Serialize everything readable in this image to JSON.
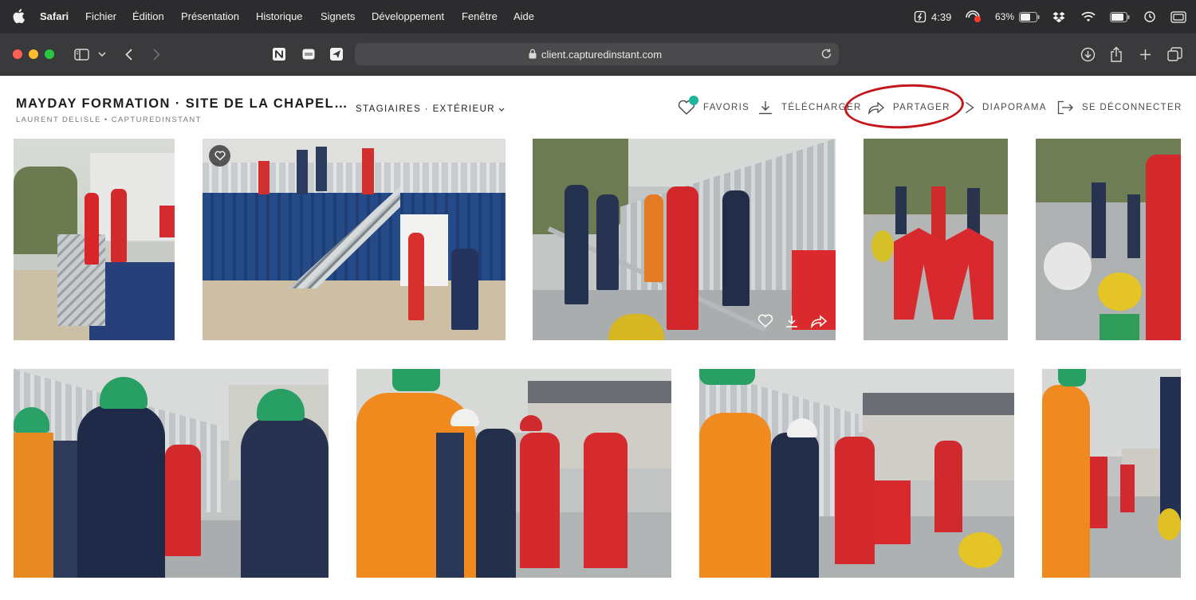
{
  "menubar": {
    "app_name": "Safari",
    "menus": [
      "Fichier",
      "Édition",
      "Présentation",
      "Historique",
      "Signets",
      "Développement",
      "Fenêtre",
      "Aide"
    ],
    "time": "4:39",
    "battery_percent": "63%",
    "battery_level": 0.63
  },
  "browser": {
    "url": "client.capturedinstant.com"
  },
  "gallery": {
    "title": "MAYDAY FORMATION · SITE DE LA CHAPEL…",
    "subtitle": "LAURENT DELISLE • CAPTUREDINSTANT",
    "album_selector": "STAGIAIRES · EXTÉRIEUR"
  },
  "actions": {
    "favorites": "FAVORIS",
    "download": "TÉLÉCHARGER",
    "share": "PARTAGER",
    "slideshow": "DIAPORAMA",
    "logout": "SE DÉCONNECTER"
  },
  "colors": {
    "menubar_bg": "#2c2c2e",
    "toolbar_bg": "#3a3a3c",
    "favorite_dot": "#1fb59a",
    "highlight_ring": "#c4161c",
    "text_dark": "#1d1d1d"
  },
  "photos": [
    {
      "scene": "rooftop-container-stairs",
      "favorite_badge": false,
      "hover_actions": false
    },
    {
      "scene": "blue-container-staircase",
      "favorite_badge": true,
      "hover_actions": false
    },
    {
      "scene": "workers-grey-building-railing",
      "favorite_badge": false,
      "hover_actions": true
    },
    {
      "scene": "red-barriers-group",
      "favorite_badge": false,
      "hover_actions": false
    },
    {
      "scene": "harness-equipment-close",
      "favorite_badge": false,
      "hover_actions": false
    },
    {
      "scene": "green-helmets-briefing",
      "favorite_badge": false,
      "hover_actions": false
    },
    {
      "scene": "orange-vest-foreground",
      "favorite_badge": false,
      "hover_actions": false
    },
    {
      "scene": "rooftop-group-red-suits",
      "favorite_badge": false,
      "hover_actions": false
    },
    {
      "scene": "orange-vest-edge",
      "favorite_badge": false,
      "hover_actions": false
    }
  ]
}
